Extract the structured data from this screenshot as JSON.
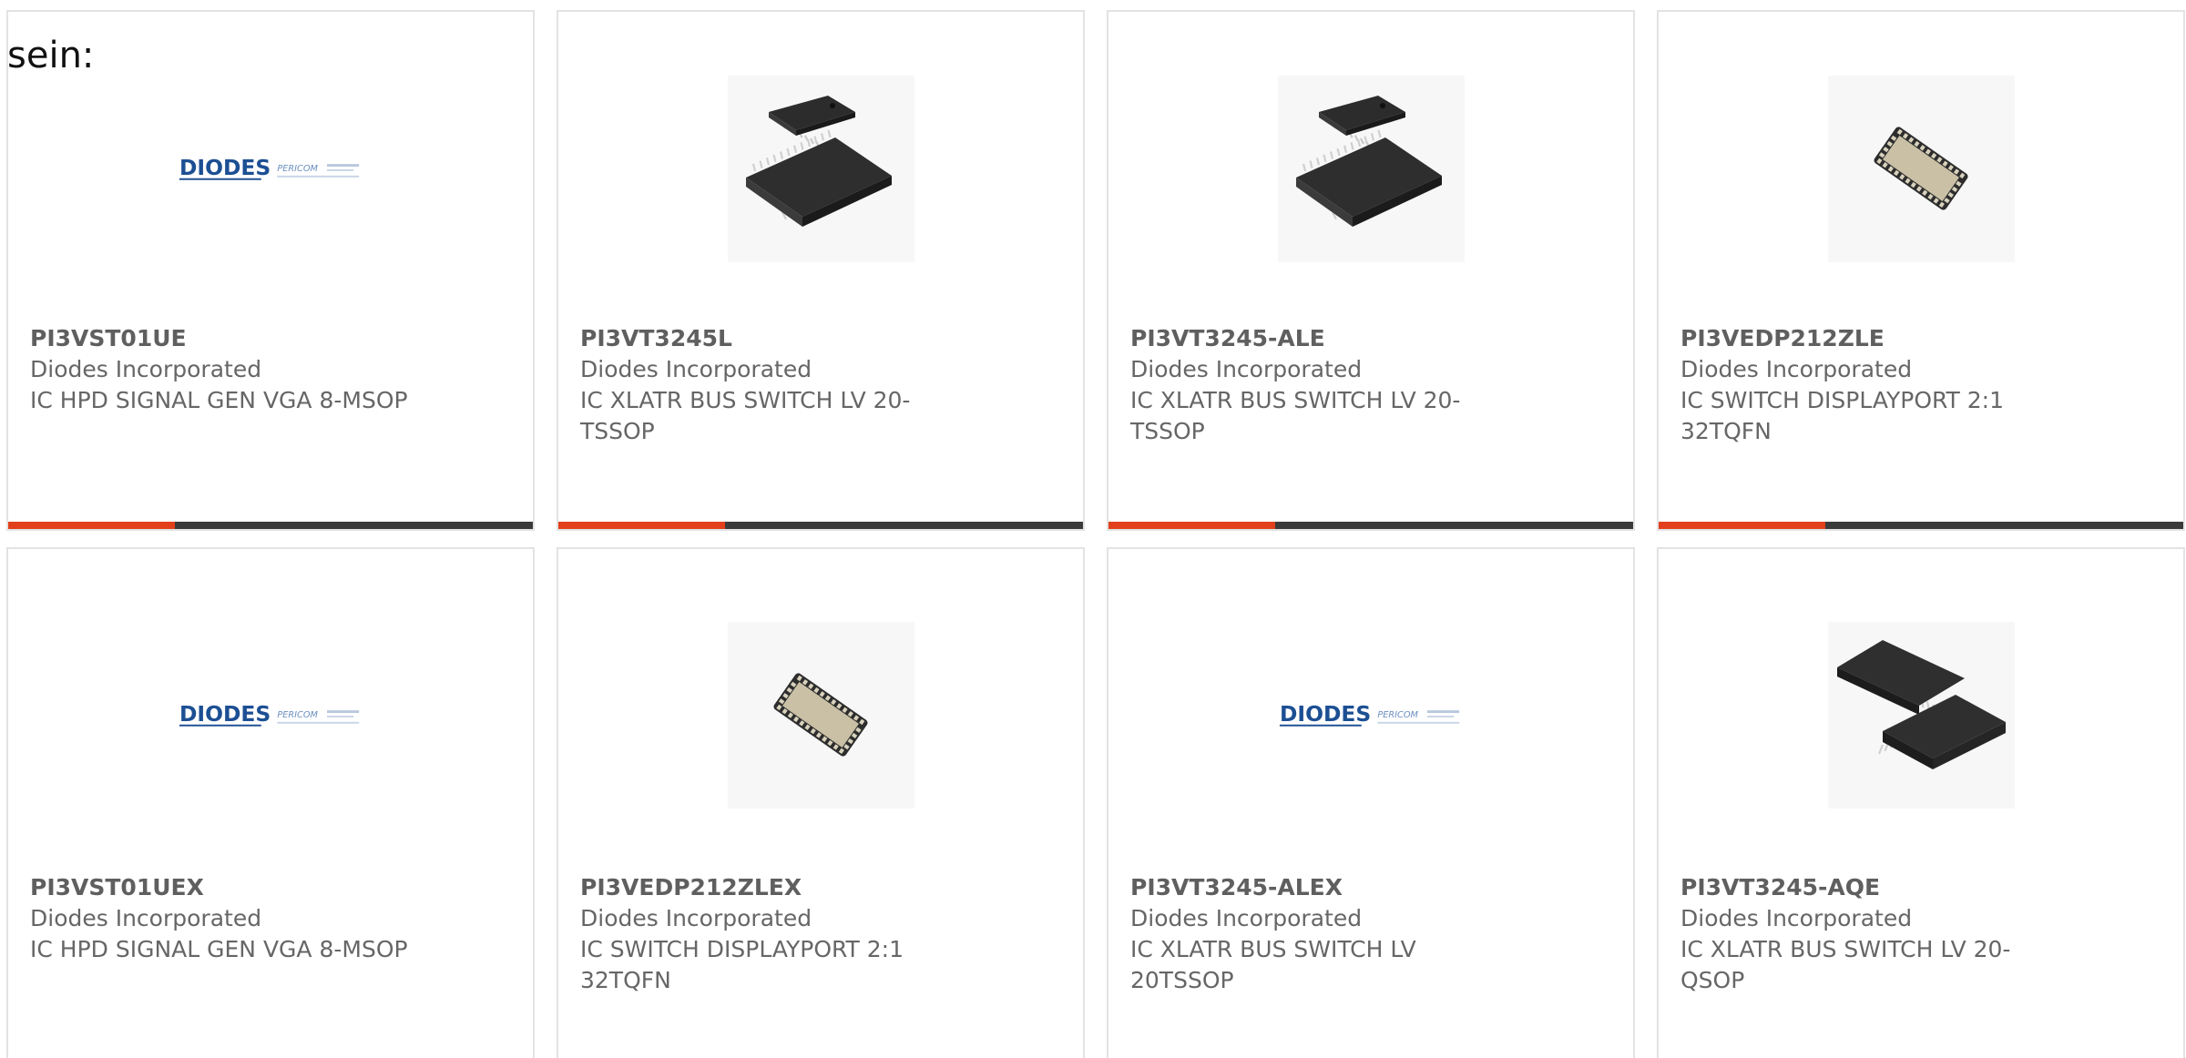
{
  "heading": "sein:",
  "colors": {
    "accent": "#e2401c",
    "bar": "#3a3a3a",
    "text": "#666666",
    "brand_blue": "#1c4f93"
  },
  "logo": {
    "brand": "DIODES",
    "sub_brand": "PERICOM"
  },
  "products": [
    {
      "part": "PI3VST01UE",
      "manufacturer": "Diodes Incorporated",
      "description": "IC HPD SIGNAL GEN VGA 8-MSOP",
      "image": "diodes-logo"
    },
    {
      "part": "PI3VT3245L",
      "manufacturer": "Diodes Incorporated",
      "description": "IC XLATR BUS SWITCH LV 20-TSSOP",
      "image": "tssop-chip-pair"
    },
    {
      "part": "PI3VT3245-ALE",
      "manufacturer": "Diodes Incorporated",
      "description": "IC XLATR BUS SWITCH LV 20-TSSOP",
      "image": "tssop-chip-pair"
    },
    {
      "part": "PI3VEDP212ZLE",
      "manufacturer": "Diodes Incorporated",
      "description": "IC SWITCH DISPLAYPORT 2:1 32TQFN",
      "image": "tqfn-chip"
    },
    {
      "part": "PI3VST01UEX",
      "manufacturer": "Diodes Incorporated",
      "description": "IC HPD SIGNAL GEN VGA 8-MSOP",
      "image": "diodes-logo"
    },
    {
      "part": "PI3VEDP212ZLEX",
      "manufacturer": "Diodes Incorporated",
      "description": "IC SWITCH DISPLAYPORT 2:1 32TQFN",
      "image": "tqfn-chip"
    },
    {
      "part": "PI3VT3245-ALEX",
      "manufacturer": "Diodes Incorporated",
      "description": "IC XLATR BUS SWITCH LV 20TSSOP",
      "image": "diodes-logo"
    },
    {
      "part": "PI3VT3245-AQE",
      "manufacturer": "Diodes Incorporated",
      "description": "IC XLATR BUS SWITCH LV 20-QSOP",
      "image": "qsop-chip-pair"
    }
  ]
}
